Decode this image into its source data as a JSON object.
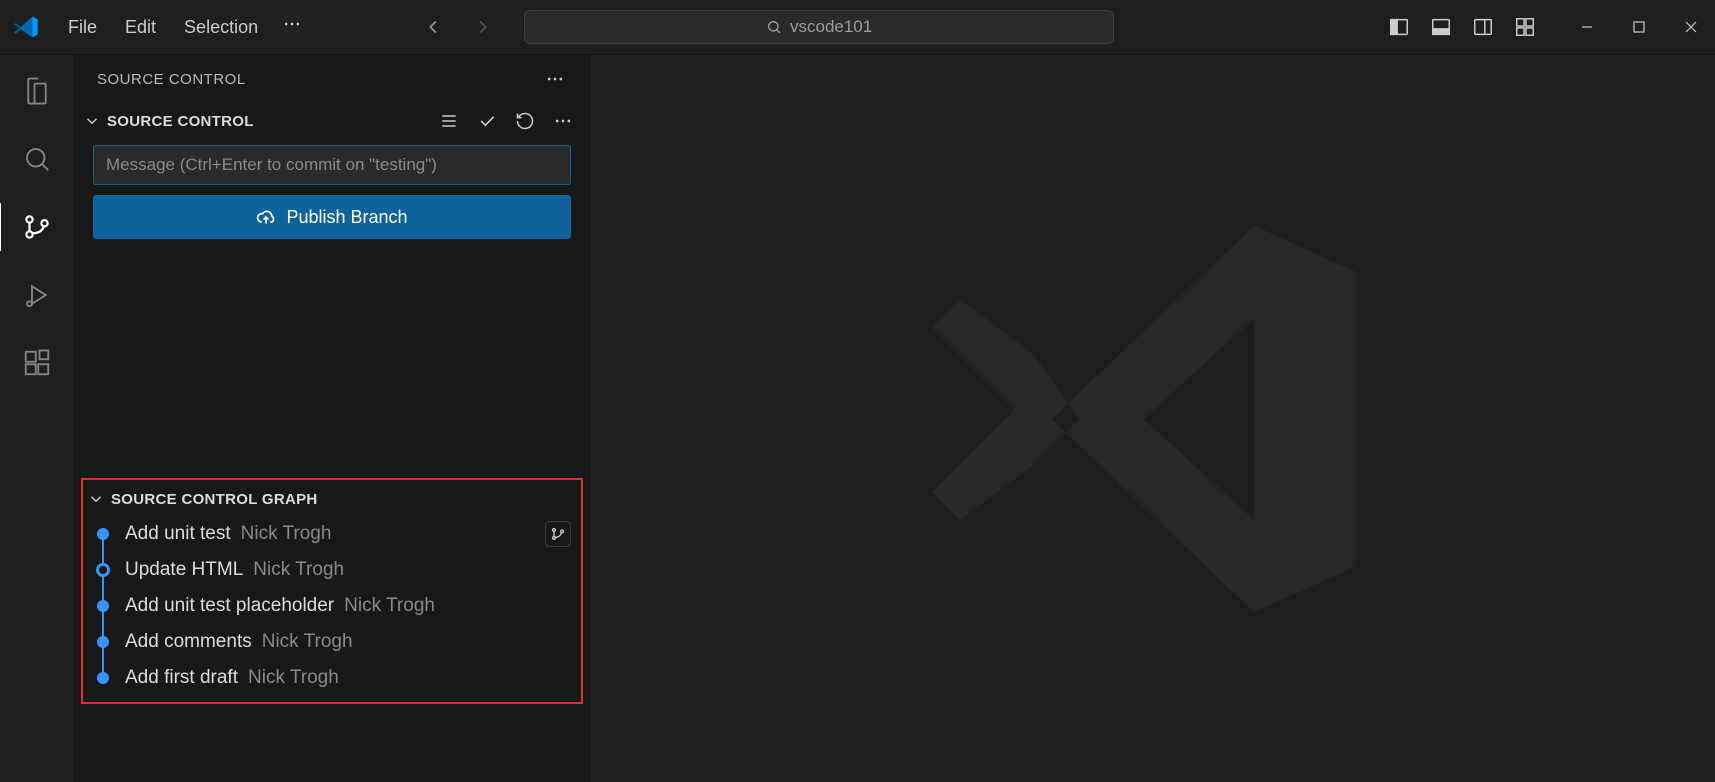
{
  "titlebar": {
    "menu": [
      "File",
      "Edit",
      "Selection"
    ],
    "search_label": "vscode101"
  },
  "panel": {
    "title": "SOURCE CONTROL",
    "section_title": "SOURCE CONTROL",
    "commit_placeholder": "Message (Ctrl+Enter to commit on \"testing\")",
    "publish_label": "Publish Branch",
    "graph_title": "SOURCE CONTROL GRAPH",
    "commits": [
      {
        "msg": "Add unit test",
        "author": "Nick Trogh",
        "current": false
      },
      {
        "msg": "Update HTML",
        "author": "Nick Trogh",
        "current": true
      },
      {
        "msg": "Add unit test placeholder",
        "author": "Nick Trogh",
        "current": false
      },
      {
        "msg": "Add comments",
        "author": "Nick Trogh",
        "current": false
      },
      {
        "msg": "Add first draft",
        "author": "Nick Trogh",
        "current": false
      }
    ]
  },
  "colors": {
    "accent": "#0e639c",
    "graph": "#3794ff",
    "highlight_border": "#e03131"
  }
}
